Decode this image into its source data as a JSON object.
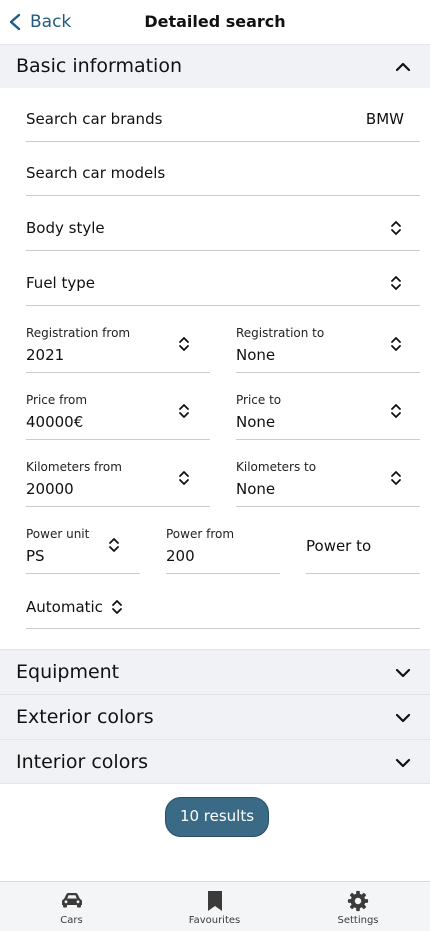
{
  "header": {
    "back_label": "Back",
    "title": "Detailed search"
  },
  "sections": {
    "basic": "Basic information",
    "equipment": "Equipment",
    "exterior": "Exterior colors",
    "interior": "Interior colors"
  },
  "basic": {
    "brands_label": "Search car brands",
    "brands_value": "BMW",
    "models_label": "Search car models",
    "body_style_label": "Body style",
    "fuel_type_label": "Fuel type",
    "registration_from": {
      "label": "Registration from",
      "value": "2021"
    },
    "registration_to": {
      "label": "Registration to",
      "value": "None"
    },
    "price_from": {
      "label": "Price from",
      "value": "40000€"
    },
    "price_to": {
      "label": "Price to",
      "value": "None"
    },
    "km_from": {
      "label": "Kilometers from",
      "value": "20000"
    },
    "km_to": {
      "label": "Kilometers to",
      "value": "None"
    },
    "power_unit": {
      "label": "Power unit",
      "value": "PS"
    },
    "power_from": {
      "label": "Power from",
      "value": "200"
    },
    "power_to_placeholder": "Power to",
    "transmission_value": "Automatic"
  },
  "results_button": "10 results",
  "tabbar": {
    "cars": "Cars",
    "favourites": "Favourites",
    "settings": "Settings"
  },
  "colors": {
    "accent": "#1f5b82",
    "button": "#3b6a86",
    "section_bg": "#f0f2f6"
  }
}
